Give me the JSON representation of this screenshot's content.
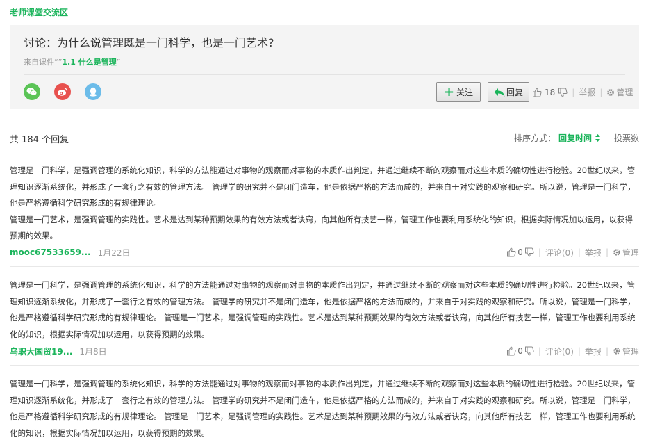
{
  "forum_link": "老师课堂交流区",
  "topic": {
    "title": "讨论：为什么说管理既是一门科学，也是一门艺术?",
    "source_prefix": "来自课件“”",
    "source_course": "1.1 什么是管理",
    "source_suffix": "”",
    "follow_label": "关注",
    "reply_label": "回复",
    "vote_count": "18",
    "report_label": "举报",
    "manage_label": "管理"
  },
  "list": {
    "count_text": "共 184 个回复",
    "sort_label": "排序方式：",
    "sort_active": "回复时间",
    "sort_vote": "投票数"
  },
  "replies": [
    {
      "text": "管理是一门科学，是强调管理的系统化知识，科学的方法能通过对事物的观察而对事物的本质作出判定，并通过继续不断的观察而对这些本质的确切性进行检验。20世纪以来，管理知识逐渐系统化，并形成了一套行之有效的管理方法。 管理学的研究并不是闭门造车，他是依据严格的方法而成的，并来自于对实践的观察和研究。所以说，管理是一门科学，他是严格遵循科学研究形成的有规律理论。\n管理是一门艺术，是强调管理的实践性。艺术是达到某种预期效果的有效方法或者诀窍，向其他所有技艺一样，管理工作也要利用系统化的知识，根据实际情况加以运用，以获得预期的效果。",
      "author": "mooc67533659...",
      "date": "1月22日",
      "votes": "0",
      "comments": "评论(0)",
      "report": "举报",
      "manage": "管理"
    },
    {
      "text": "管理是一门科学，是强调管理的系统化知识，科学的方法能通过对事物的观察而对事物的本质作出判定，并通过继续不断的观察而对这些本质的确切性进行检验。20世纪以来，管理知识逐渐系统化，并形成了一套行之有效的管理方法。 管理学的研究并不是闭门造车，他是依据严格的方法而成的，并来自于对实践的观察和研究。所以说，管理是一门科学，他是严格遵循科学研究形成的有规律理论。 管理是一门艺术，是强调管理的实践性。艺术是达到某种预期效果的有效方法或者诀窍，向其他所有技艺一样，管理工作也要利用系统化的知识，根据实际情况加以运用，以获得预期的效果。",
      "author": "乌职大国贸19...",
      "date": "1月8日",
      "votes": "0",
      "comments": "评论(0)",
      "report": "举报",
      "manage": "管理"
    },
    {
      "text": "管理是一门科学，是强调管理的系统化知识，科学的方法能通过对事物的观察而对事物的本质作出判定，并通过继续不断的观察而对这些本质的确切性进行检验。20世纪以来，管理知识逐渐系统化，并形成了一套行之有效的管理方法。 管理学的研究并不是闭门造车，他是依据严格的方法而成的，并来自于对实践的观察和研究。所以说，管理是一门科学，他是严格遵循科学研究形成的有规律理论。 管理是一门艺术，是强调管理的实践性。艺术是达到某种预期效果的有效方法或者诀窍，向其他所有技艺一样，管理工作也要利用系统化的知识，根据实际情况加以运用，以获得预期的效果。"
    }
  ],
  "colors": {
    "accent": "#1bb45b",
    "wechat": "#5bc456",
    "weibo": "#e8514e",
    "qq": "#6cbce9"
  },
  "icons": [
    "wechat-icon",
    "weibo-icon",
    "qq-icon",
    "plus-icon",
    "reply-arrow-icon",
    "thumbs-up-icon",
    "thumbs-down-icon",
    "gear-icon",
    "sort-arrows-icon"
  ]
}
